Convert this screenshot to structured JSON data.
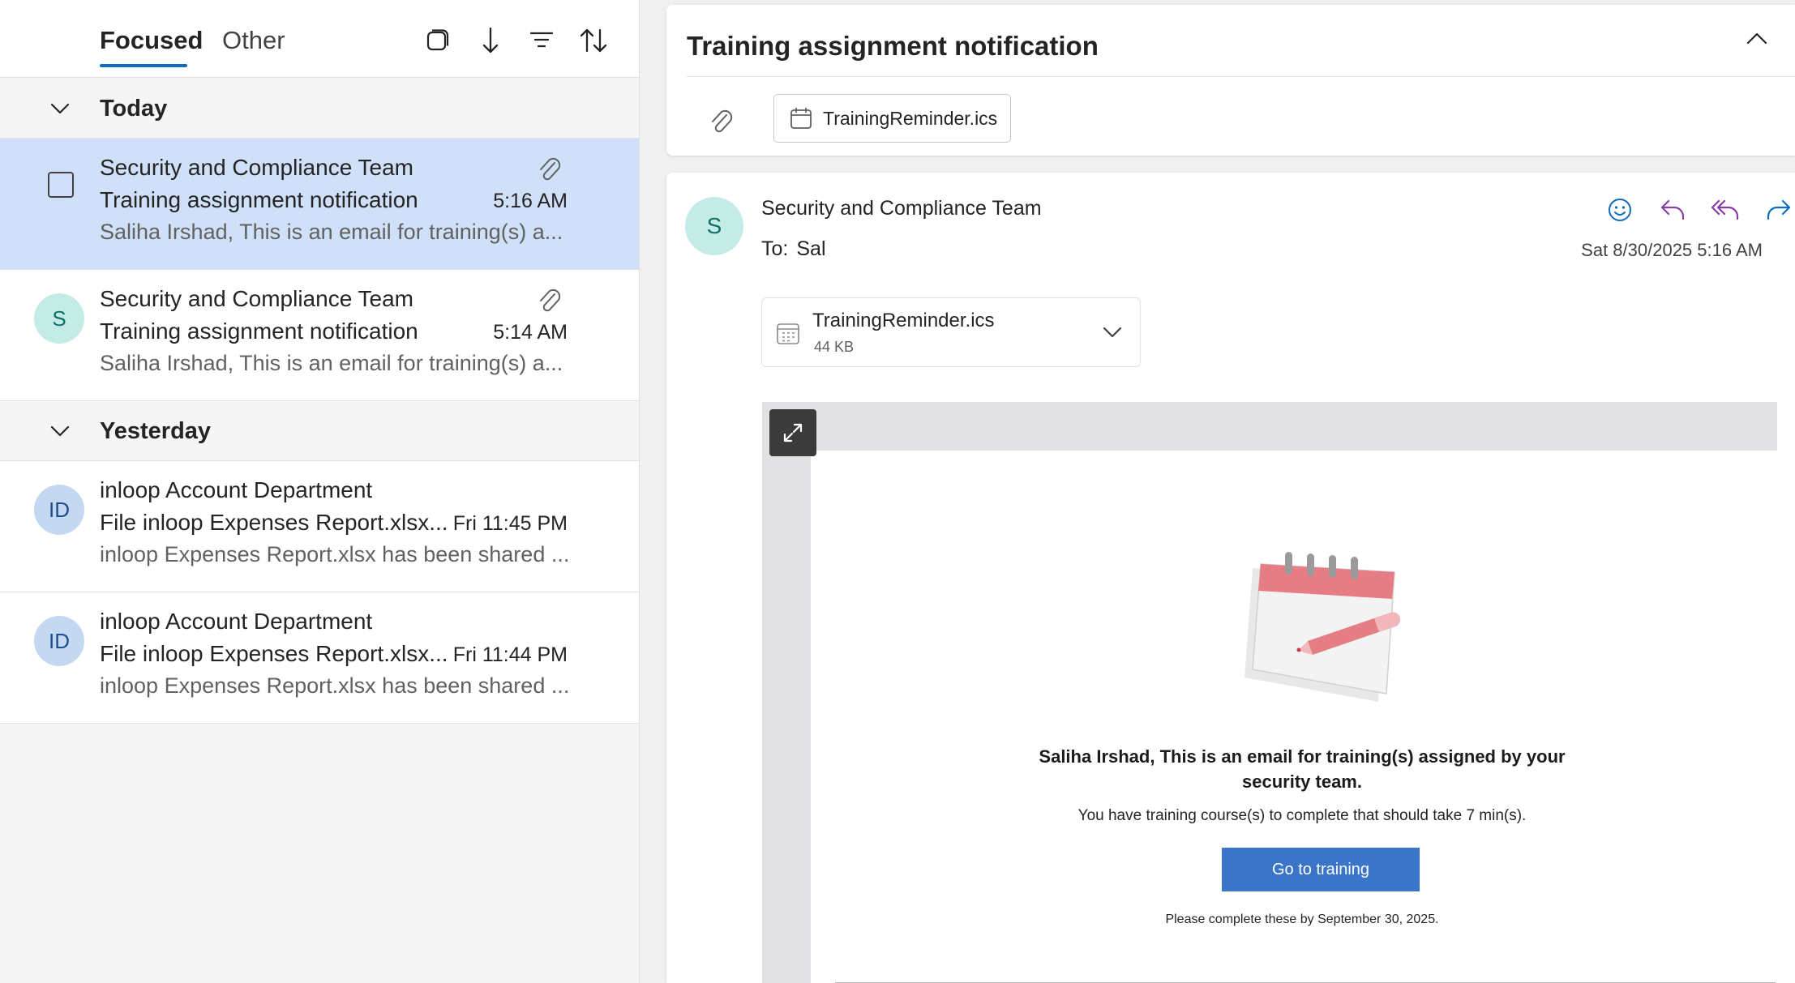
{
  "list": {
    "tabs": {
      "focused": "Focused",
      "other": "Other"
    },
    "groups": {
      "today": "Today",
      "yesterday": "Yesterday"
    },
    "messages": [
      {
        "sender": "Security and Compliance Team",
        "subject": "Training assignment notification",
        "preview": "Saliha Irshad, This is an email for training(s) a...",
        "time": "5:16 AM",
        "selected": true,
        "has_attachment": true
      },
      {
        "initials": "S",
        "sender": "Security and Compliance Team",
        "subject": "Training assignment notification",
        "preview": "Saliha Irshad, This is an email for training(s) a...",
        "time": "5:14 AM",
        "has_attachment": true
      },
      {
        "initials": "ID",
        "sender": "inloop Account Department",
        "subject": "File inloop Expenses Report.xlsx...",
        "preview": "inloop Expenses Report.xlsx has been shared ...",
        "time": "Fri 11:45 PM"
      },
      {
        "initials": "ID",
        "sender": "inloop Account Department",
        "subject": "File inloop Expenses Report.xlsx...",
        "preview": "inloop Expenses Report.xlsx has been shared ...",
        "time": "Fri 11:44 PM"
      }
    ]
  },
  "reading": {
    "subject": "Training assignment notification",
    "attachment_chip": "TrainingReminder.ics",
    "sender_initial": "S",
    "sender": "Security and Compliance Team",
    "to_label": "To:",
    "to_value": "Sal",
    "date": "Sat 8/30/2025 5:16 AM",
    "attachment": {
      "name": "TrainingReminder.ics",
      "size": "44 KB"
    },
    "email": {
      "headline": "Saliha Irshad, This is an email for training(s) assigned by your security team.",
      "body": "You have training course(s) to complete that should take 7 min(s).",
      "button": "Go to training",
      "deadline": "Please complete these by September 30, 2025."
    }
  },
  "colors": {
    "accent": "#0f6cbd",
    "selected_row": "#cfe0f8",
    "avatar_teal": "#c5ebe7",
    "avatar_blue": "#c4d9f1",
    "reply_purple": "#8a3ca6",
    "button_blue": "#3a75c9"
  },
  "icons": [
    "select-mode-icon",
    "jump-icon",
    "filter-icon",
    "sort-icon",
    "paperclip-icon",
    "calendar-icon",
    "chevron-down-icon",
    "chevron-up-icon",
    "emoji-icon",
    "reply-icon",
    "reply-all-icon",
    "forward-icon",
    "immersive-reader-icon",
    "apps-icon",
    "more-icon",
    "expand-icon"
  ]
}
